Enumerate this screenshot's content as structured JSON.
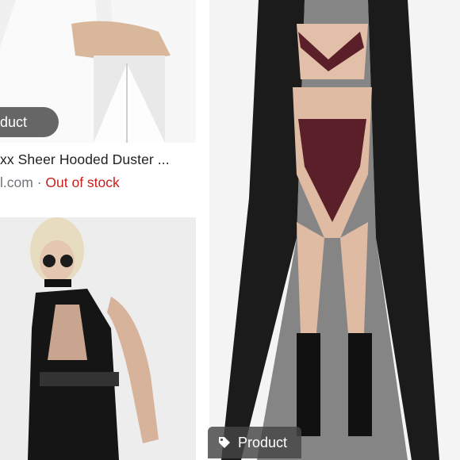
{
  "results": [
    {
      "badge_label": "duct",
      "title": "xx Sheer Hooded Duster ...",
      "source": "l.com",
      "separator": "·",
      "stock_status": "Out of stock",
      "stock_color": "#c5221f"
    },
    {
      "badge_label": "Product"
    }
  ],
  "icons": {
    "badge": "tag-icon"
  }
}
